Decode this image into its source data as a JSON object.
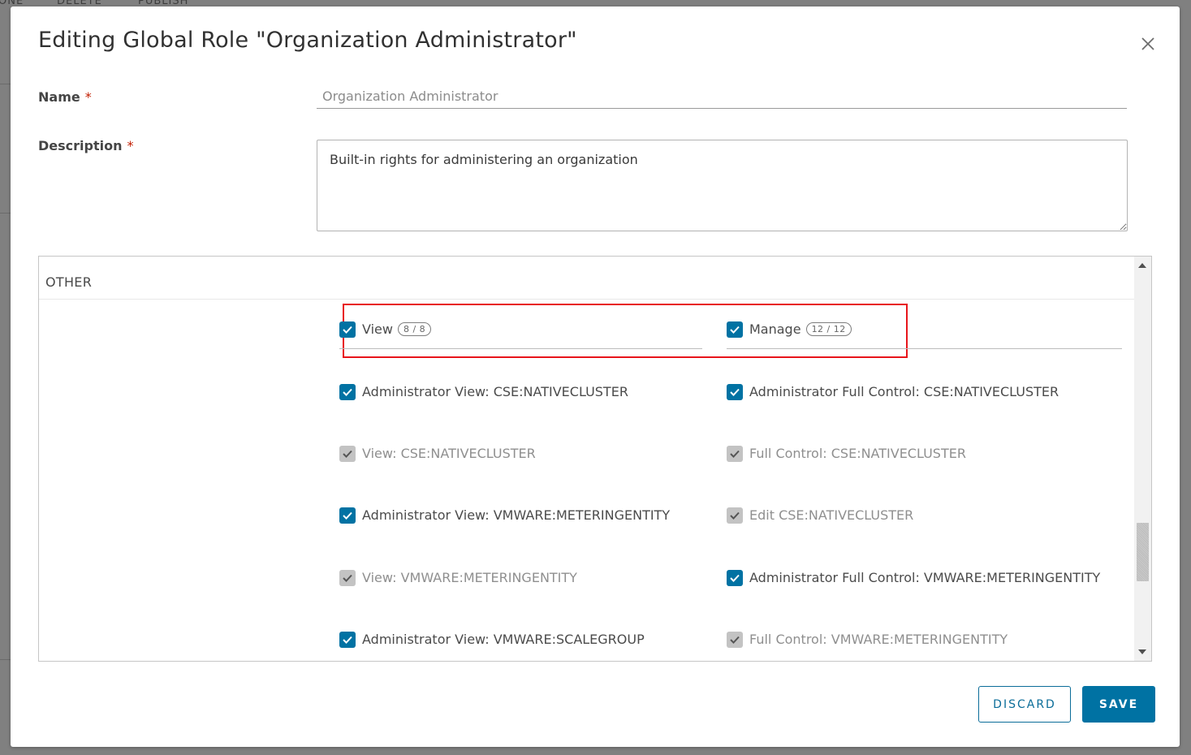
{
  "background": {
    "toolbar_items": [
      "ONE",
      "DELETE",
      "PUBLISH"
    ]
  },
  "dialog": {
    "title": "Editing Global Role \"Organization Administrator\"",
    "close_icon": "close-icon",
    "name": {
      "label": "Name",
      "required_mark": "*",
      "value": "Organization Administrator"
    },
    "description": {
      "label": "Description",
      "required_mark": "*",
      "value": "Built-in rights for administering an organization"
    }
  },
  "rights": {
    "category": "OTHER",
    "groups": {
      "view": {
        "label": "View",
        "count": "8 / 8",
        "checked": true
      },
      "manage": {
        "label": "Manage",
        "count": "12 / 12",
        "checked": true
      }
    },
    "view_items": [
      {
        "label": "Administrator View: CSE:NATIVECLUSTER",
        "checked": true,
        "disabled": false
      },
      {
        "label": "View: CSE:NATIVECLUSTER",
        "checked": true,
        "disabled": true
      },
      {
        "label": "Administrator View: VMWARE:METERINGENTITY",
        "checked": true,
        "disabled": false
      },
      {
        "label": "View: VMWARE:METERINGENTITY",
        "checked": true,
        "disabled": true
      },
      {
        "label": "Administrator View: VMWARE:SCALEGROUP",
        "checked": true,
        "disabled": false
      }
    ],
    "manage_items": [
      {
        "label": "Administrator Full Control: CSE:NATIVECLUSTER",
        "checked": true,
        "disabled": false
      },
      {
        "label": "Full Control: CSE:NATIVECLUSTER",
        "checked": true,
        "disabled": true
      },
      {
        "label": "Edit CSE:NATIVECLUSTER",
        "checked": true,
        "disabled": true
      },
      {
        "label": "Administrator Full Control: VMWARE:METERINGENTITY",
        "checked": true,
        "disabled": false
      },
      {
        "label": "Full Control: VMWARE:METERINGENTITY",
        "checked": true,
        "disabled": true
      }
    ]
  },
  "footer": {
    "discard_label": "DISCARD",
    "save_label": "SAVE"
  },
  "colors": {
    "accent": "#0072a3",
    "checkbox_disabled": "#c3c3c3",
    "highlight": "#e8151b",
    "required": "#c21d00"
  }
}
